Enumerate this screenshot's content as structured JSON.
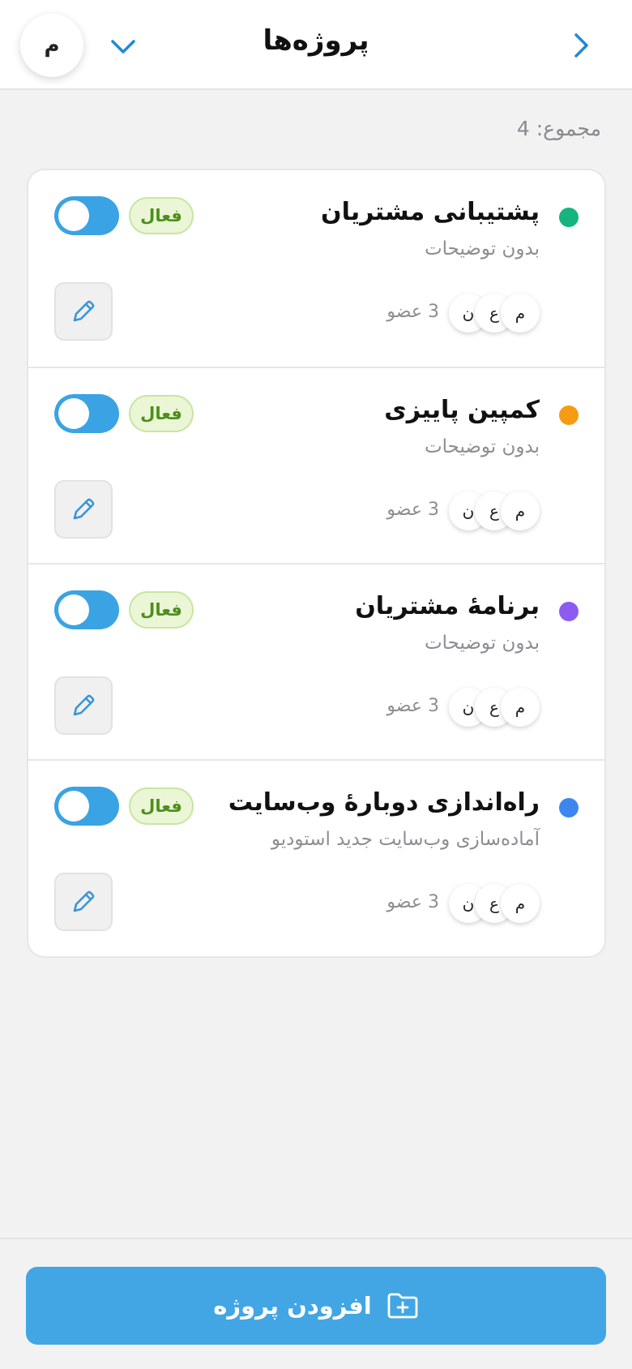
{
  "header": {
    "title": "پروژه‌ها",
    "back_icon": "chevron-right-icon",
    "switch_icon": "chevron-down-icon",
    "user_initial": "م"
  },
  "summary": {
    "total_label": "مجموع: 4"
  },
  "colors": {
    "accent": "#42a6e4",
    "toggle": "#3aa3e3",
    "badge_bg": "#eaf6d6",
    "badge_text": "#4c8f1b"
  },
  "projects": [
    {
      "name": "پشتیبانی مشتریان",
      "description": "بدون توضیحات",
      "color": "#16b47e",
      "status": "فعال",
      "active": true,
      "avatars": [
        "م",
        "ع",
        "ن"
      ],
      "members": "3 عضو"
    },
    {
      "name": "کمپین پاییزی",
      "description": "بدون توضیحات",
      "color": "#f59c12",
      "status": "فعال",
      "active": true,
      "avatars": [
        "م",
        "ع",
        "ن"
      ],
      "members": "3 عضو"
    },
    {
      "name": "برنامهٔ مشتریان",
      "description": "بدون توضیحات",
      "color": "#8c5cf2",
      "status": "فعال",
      "active": true,
      "avatars": [
        "م",
        "ع",
        "ن"
      ],
      "members": "3 عضو"
    },
    {
      "name": "راه‌اندازی دوبارهٔ وب‌سایت",
      "description": "آماده‌سازی وب‌سایت جدید استودیو",
      "color": "#3d86f0",
      "status": "فعال",
      "active": true,
      "avatars": [
        "م",
        "ع",
        "ن"
      ],
      "members": "3 عضو"
    }
  ],
  "footer": {
    "add_label": "افزودن پروژه",
    "add_icon": "folder-plus-icon"
  }
}
